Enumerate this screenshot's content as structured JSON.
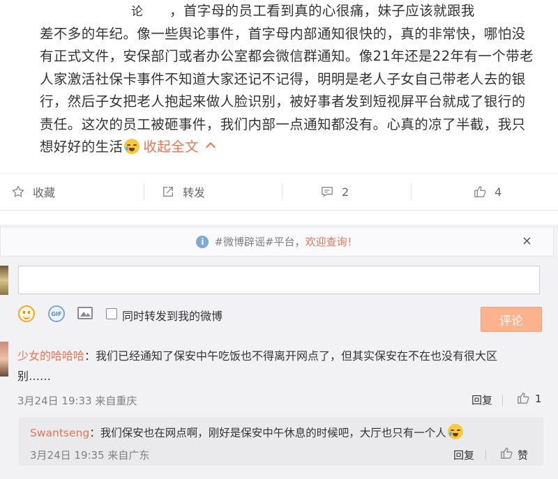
{
  "post": {
    "fragment_left": "论",
    "line1": "，首字母的员工看到真的心很痛，妹子应该就跟我",
    "line2": "差不多的年纪。像一些舆论事件，首字母内部通知很快的，真的非常快，哪怕没",
    "line3": "有正式文件，安保部门或者办公室都会微信群通知。像21年还是22年有一个带老",
    "line4": "人家激活社保卡事件不知道大家还记不记得，明明是老人子女自己带老人去的银",
    "line5": "行，然后子女把老人抱起来做人脸识别，被好事者发到短视屏平台就成了银行的",
    "line6": "责任。这次的员工被砸事件，我们内部一点通知都没有。心真的凉了半截，我只",
    "line7": "想好好的生活",
    "collapse_label": "收起全文",
    "emoji_icon": "sad-face-icon"
  },
  "actions": {
    "favorite": {
      "label": "收藏",
      "icon": "star-icon"
    },
    "repost": {
      "label": "转发",
      "icon": "share-icon"
    },
    "comment": {
      "label": "2",
      "icon": "comment-icon"
    },
    "like": {
      "label": "4",
      "icon": "thumb-up-icon"
    }
  },
  "notice": {
    "text_a": "#微博辟谣#平台，",
    "text_b": "欢迎查询！",
    "close": "×"
  },
  "composer": {
    "placeholder": "",
    "repost_checkbox_label": "同时转发到我的微博",
    "submit_label": "评论",
    "gif_label": "GIF"
  },
  "comments": [
    {
      "user": "少女的哈哈哈",
      "separator": "：",
      "text_line1": "我们已经通知了保安中午吃饭也不得离开网点了，但其实保安在不在也没有很大区",
      "text_line2": "别……",
      "date": "3月24日 19:33",
      "source": "来自重庆",
      "reply_label": "回复",
      "like_count": "1"
    }
  ],
  "reply": {
    "user": "Swantseng",
    "separator": "：",
    "text": "我们保安也在网点啊，刚好是保安中午休息的时候吧，大厅也只有一个人",
    "date": "3月24日 19:35",
    "source": "来自广东",
    "reply_label": "回复",
    "like_label": "赞"
  },
  "colors": {
    "accent": "#eb7350",
    "submit_bg": "#fbb28d",
    "comment_area_bg": "#f2f2f5"
  }
}
